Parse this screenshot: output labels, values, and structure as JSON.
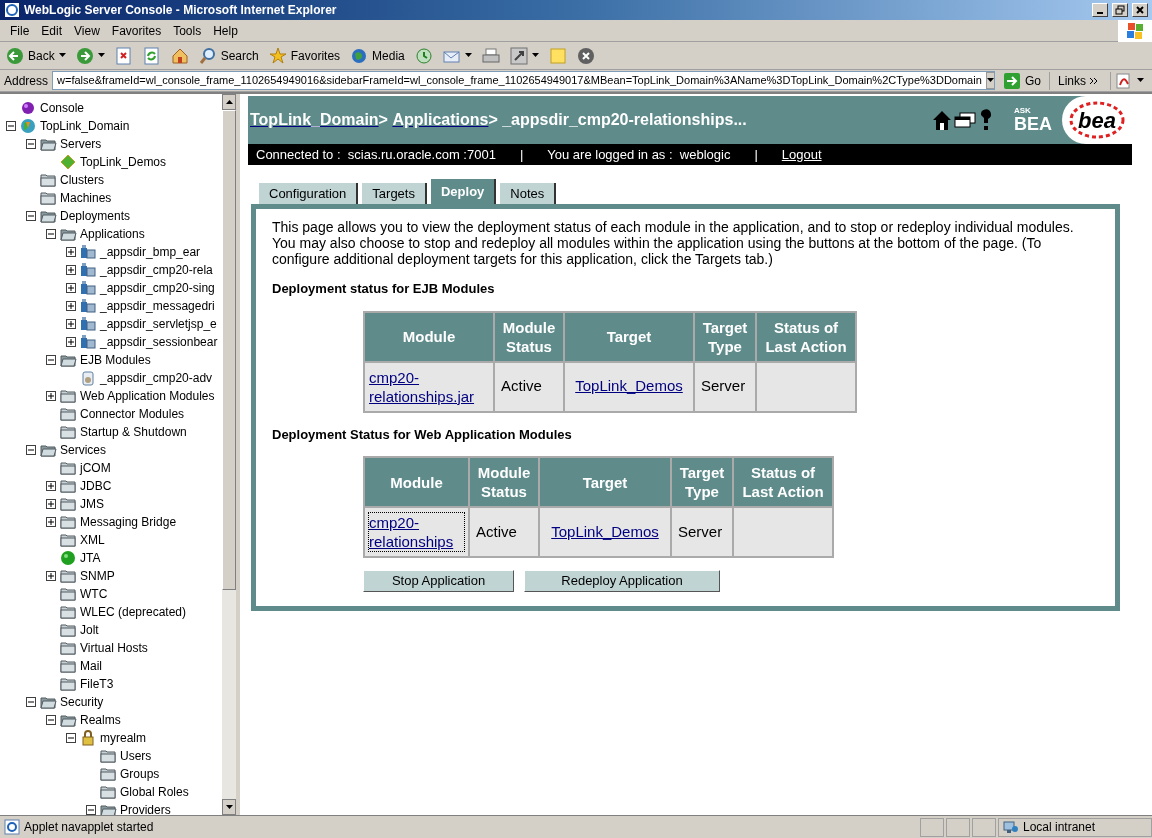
{
  "window": {
    "title": "WebLogic Server Console - Microsoft Internet Explorer"
  },
  "menu": [
    "File",
    "Edit",
    "View",
    "Favorites",
    "Tools",
    "Help"
  ],
  "toolbar": [
    {
      "kind": "back",
      "label": "Back"
    },
    {
      "kind": "forward"
    },
    {
      "kind": "stop"
    },
    {
      "kind": "refresh"
    },
    {
      "kind": "home"
    },
    {
      "kind": "search",
      "label": "Search"
    },
    {
      "kind": "favorites",
      "label": "Favorites"
    },
    {
      "kind": "media",
      "label": "Media"
    },
    {
      "kind": "history"
    },
    {
      "kind": "mail"
    },
    {
      "kind": "print"
    },
    {
      "kind": "edit"
    },
    {
      "kind": "note"
    },
    {
      "kind": "messenger"
    }
  ],
  "address": {
    "label": "Address",
    "value": "w=false&frameId=wl_console_frame_1102654949016&sidebarFrameId=wl_console_frame_1102654949017&MBean=TopLink_Domain%3AName%3DTopLink_Domain%2CType%3DDomain",
    "go": "Go",
    "links": "Links"
  },
  "tree": [
    {
      "label": "Console",
      "kind": "console"
    },
    {
      "label": "TopLink_Domain",
      "kind": "domain",
      "expanded": true,
      "children": [
        {
          "label": "Servers",
          "kind": "folder",
          "expanded": true,
          "children": [
            {
              "label": "TopLink_Demos",
              "kind": "server"
            }
          ]
        },
        {
          "label": "Clusters",
          "kind": "folder"
        },
        {
          "label": "Machines",
          "kind": "folder"
        },
        {
          "label": "Deployments",
          "kind": "folder",
          "expanded": true,
          "children": [
            {
              "label": "Applications",
              "kind": "folder",
              "expanded": true,
              "children": [
                {
                  "label": "_appsdir_bmp_ear",
                  "kind": "app",
                  "expanded": false
                },
                {
                  "label": "_appsdir_cmp20-rela",
                  "kind": "app",
                  "expanded": false
                },
                {
                  "label": "_appsdir_cmp20-sing",
                  "kind": "app",
                  "expanded": false
                },
                {
                  "label": "_appsdir_messagedri",
                  "kind": "app",
                  "expanded": false
                },
                {
                  "label": "_appsdir_servletjsp_e",
                  "kind": "app",
                  "expanded": false
                },
                {
                  "label": "_appsdir_sessionbear",
                  "kind": "app",
                  "expanded": false
                }
              ]
            },
            {
              "label": "EJB Modules",
              "kind": "folder",
              "expanded": true,
              "children": [
                {
                  "label": "_appsdir_cmp20-adv",
                  "kind": "ejb"
                }
              ]
            },
            {
              "label": "Web Application Modules",
              "kind": "folder",
              "expanded": false
            },
            {
              "label": "Connector Modules",
              "kind": "folder"
            },
            {
              "label": "Startup & Shutdown",
              "kind": "folder"
            }
          ]
        },
        {
          "label": "Services",
          "kind": "folder",
          "expanded": true,
          "children": [
            {
              "label": "jCOM",
              "kind": "folder"
            },
            {
              "label": "JDBC",
              "kind": "folder",
              "expanded": false
            },
            {
              "label": "JMS",
              "kind": "folder",
              "expanded": false
            },
            {
              "label": "Messaging Bridge",
              "kind": "folder",
              "expanded": false
            },
            {
              "label": "XML",
              "kind": "folder"
            },
            {
              "label": "JTA",
              "kind": "jta"
            },
            {
              "label": "SNMP",
              "kind": "folder",
              "expanded": false
            },
            {
              "label": "WTC",
              "kind": "folder"
            },
            {
              "label": "WLEC (deprecated)",
              "kind": "folder"
            },
            {
              "label": "Jolt",
              "kind": "folder"
            },
            {
              "label": "Virtual Hosts",
              "kind": "folder"
            },
            {
              "label": "Mail",
              "kind": "folder"
            },
            {
              "label": "FileT3",
              "kind": "folder"
            }
          ]
        },
        {
          "label": "Security",
          "kind": "folder",
          "expanded": true,
          "children": [
            {
              "label": "Realms",
              "kind": "folder",
              "expanded": true,
              "children": [
                {
                  "label": "myrealm",
                  "kind": "lock",
                  "expanded": true,
                  "children": [
                    {
                      "label": "Users",
                      "kind": "folder"
                    },
                    {
                      "label": "Groups",
                      "kind": "folder"
                    },
                    {
                      "label": "Global Roles",
                      "kind": "folder"
                    },
                    {
                      "label": "Providers",
                      "kind": "folder",
                      "expanded": true
                    }
                  ]
                }
              ]
            }
          ]
        }
      ]
    }
  ],
  "header": {
    "breadcrumb": [
      {
        "text": "TopLink_Domain",
        "link": true
      },
      {
        "text": "> ",
        "link": false
      },
      {
        "text": "Applications",
        "link": true
      },
      {
        "text": "> _appsdir_cmp20-relationships...",
        "link": false
      }
    ],
    "ask": "ASK",
    "bea": "BEA",
    "logo": "bea"
  },
  "connection": {
    "connected": "Connected to :  scias.ru.oracle.com :7001",
    "sep1": "|",
    "user": "You are logged in as :  weblogic",
    "sep2": "|",
    "logout": "Logout"
  },
  "tabs": [
    {
      "label": "Configuration",
      "selected": false
    },
    {
      "label": "Targets",
      "selected": false
    },
    {
      "label": "Deploy",
      "selected": true
    },
    {
      "label": "Notes",
      "selected": false
    }
  ],
  "intro": "This page allows you to view the deployment status of each module in the application, and to stop or redeploy individual modules. You may also choose to stop and redeploy all modules within the application using the buttons at the bottom of the page. (To configure additional deployment targets for this application, click the Targets tab.)",
  "sections": [
    {
      "title": "Deployment status for EJB Modules",
      "columns": [
        "Module",
        "Module Status",
        "Target",
        "Target Type",
        "Status of Last Action"
      ],
      "rows": [
        {
          "module": "cmp20-relationships.jar",
          "status": "Active",
          "target": "TopLink_Demos",
          "type": "Server",
          "focused": false
        }
      ]
    },
    {
      "title": "Deployment Status for Web Application Modules",
      "columns": [
        "Module",
        "Module Status",
        "Target",
        "Target Type",
        "Status of Last Action"
      ],
      "rows": [
        {
          "module": "cmp20-relationships",
          "status": "Active",
          "target": "TopLink_Demos",
          "type": "Server",
          "focused": true
        }
      ]
    }
  ],
  "buttons": [
    "Stop Application",
    "Redeploy Application"
  ],
  "status_bar": {
    "text": "Applet navapplet started",
    "zone": "Local intranet"
  }
}
